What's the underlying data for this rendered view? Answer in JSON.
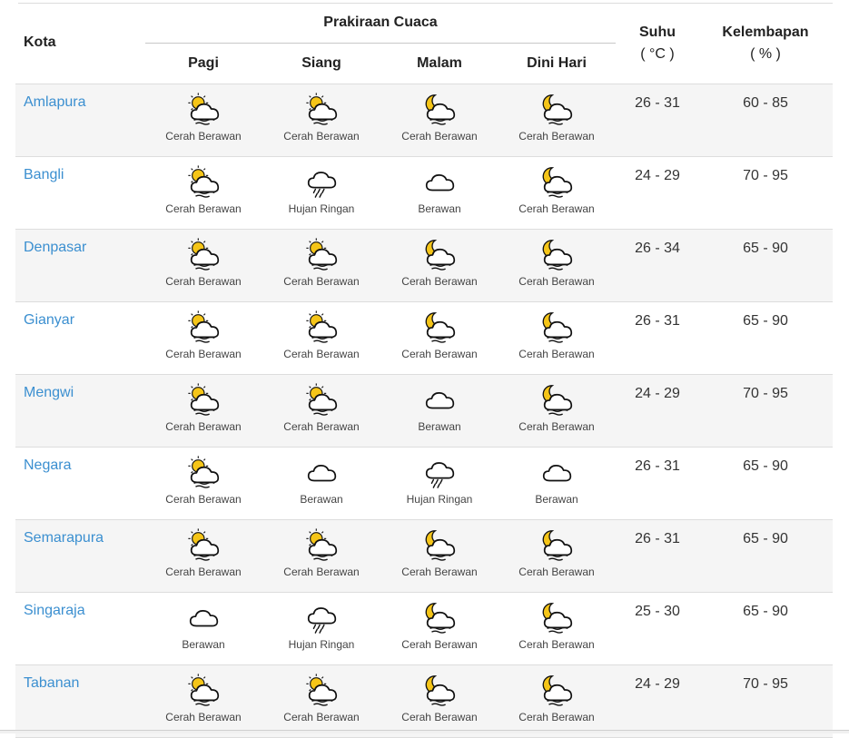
{
  "table": {
    "headers": {
      "city": "Kota",
      "forecast_group": "Prakiraan Cuaca",
      "periods": [
        "Pagi",
        "Siang",
        "Malam",
        "Dini Hari"
      ],
      "temp_line1": "Suhu",
      "temp_line2": "( °C )",
      "humidity_line1": "Kelembapan",
      "humidity_line2": "( % )"
    },
    "rows": [
      {
        "city": "Amlapura",
        "forecast": [
          {
            "icon": "sun-cloud-icon",
            "label": "Cerah Berawan"
          },
          {
            "icon": "sun-cloud-icon",
            "label": "Cerah Berawan"
          },
          {
            "icon": "moon-cloud-icon",
            "label": "Cerah Berawan"
          },
          {
            "icon": "moon-cloud-icon",
            "label": "Cerah Berawan"
          }
        ],
        "temp": "26 - 31",
        "humidity": "60 - 85"
      },
      {
        "city": "Bangli",
        "forecast": [
          {
            "icon": "sun-cloud-icon",
            "label": "Cerah Berawan"
          },
          {
            "icon": "rain-cloud-icon",
            "label": "Hujan Ringan"
          },
          {
            "icon": "cloud-icon",
            "label": "Berawan"
          },
          {
            "icon": "moon-cloud-icon",
            "label": "Cerah Berawan"
          }
        ],
        "temp": "24 - 29",
        "humidity": "70 - 95"
      },
      {
        "city": "Denpasar",
        "forecast": [
          {
            "icon": "sun-cloud-icon",
            "label": "Cerah Berawan"
          },
          {
            "icon": "sun-cloud-icon",
            "label": "Cerah Berawan"
          },
          {
            "icon": "moon-cloud-icon",
            "label": "Cerah Berawan"
          },
          {
            "icon": "moon-cloud-icon",
            "label": "Cerah Berawan"
          }
        ],
        "temp": "26 - 34",
        "humidity": "65 - 90"
      },
      {
        "city": "Gianyar",
        "forecast": [
          {
            "icon": "sun-cloud-icon",
            "label": "Cerah Berawan"
          },
          {
            "icon": "sun-cloud-icon",
            "label": "Cerah Berawan"
          },
          {
            "icon": "moon-cloud-icon",
            "label": "Cerah Berawan"
          },
          {
            "icon": "moon-cloud-icon",
            "label": "Cerah Berawan"
          }
        ],
        "temp": "26 - 31",
        "humidity": "65 - 90"
      },
      {
        "city": "Mengwi",
        "forecast": [
          {
            "icon": "sun-cloud-icon",
            "label": "Cerah Berawan"
          },
          {
            "icon": "sun-cloud-icon",
            "label": "Cerah Berawan"
          },
          {
            "icon": "cloud-icon",
            "label": "Berawan"
          },
          {
            "icon": "moon-cloud-icon",
            "label": "Cerah Berawan"
          }
        ],
        "temp": "24 - 29",
        "humidity": "70 - 95"
      },
      {
        "city": "Negara",
        "forecast": [
          {
            "icon": "sun-cloud-icon",
            "label": "Cerah Berawan"
          },
          {
            "icon": "cloud-icon",
            "label": "Berawan"
          },
          {
            "icon": "rain-cloud-icon",
            "label": "Hujan Ringan"
          },
          {
            "icon": "cloud-icon",
            "label": "Berawan"
          }
        ],
        "temp": "26 - 31",
        "humidity": "65 - 90"
      },
      {
        "city": "Semarapura",
        "forecast": [
          {
            "icon": "sun-cloud-icon",
            "label": "Cerah Berawan"
          },
          {
            "icon": "sun-cloud-icon",
            "label": "Cerah Berawan"
          },
          {
            "icon": "moon-cloud-icon",
            "label": "Cerah Berawan"
          },
          {
            "icon": "moon-cloud-icon",
            "label": "Cerah Berawan"
          }
        ],
        "temp": "26 - 31",
        "humidity": "65 - 90"
      },
      {
        "city": "Singaraja",
        "forecast": [
          {
            "icon": "cloud-icon",
            "label": "Berawan"
          },
          {
            "icon": "rain-cloud-icon",
            "label": "Hujan Ringan"
          },
          {
            "icon": "moon-cloud-icon",
            "label": "Cerah Berawan"
          },
          {
            "icon": "moon-cloud-icon",
            "label": "Cerah Berawan"
          }
        ],
        "temp": "25 - 30",
        "humidity": "65 - 90"
      },
      {
        "city": "Tabanan",
        "forecast": [
          {
            "icon": "sun-cloud-icon",
            "label": "Cerah Berawan"
          },
          {
            "icon": "sun-cloud-icon",
            "label": "Cerah Berawan"
          },
          {
            "icon": "moon-cloud-icon",
            "label": "Cerah Berawan"
          },
          {
            "icon": "moon-cloud-icon",
            "label": "Cerah Berawan"
          }
        ],
        "temp": "24 - 29",
        "humidity": "70 - 95"
      }
    ]
  },
  "colors": {
    "link": "#3b8fd0",
    "sun": "#f5c518",
    "row_alt": "#f5f5f5"
  }
}
